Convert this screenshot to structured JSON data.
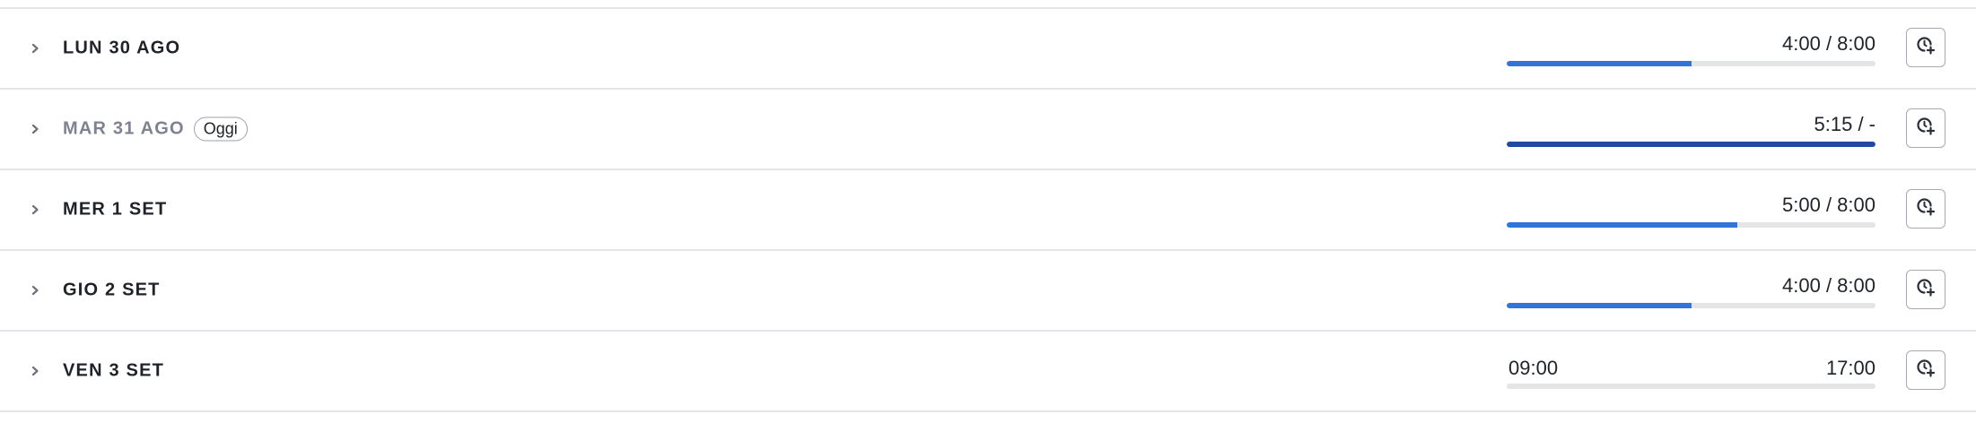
{
  "colors": {
    "progress_fill": "#3274d9",
    "progress_fill_over": "#1f4aa0",
    "progress_track": "#e4e5e7",
    "divider": "#e3e5e8",
    "today_label": "#7e838d"
  },
  "days": [
    {
      "label": "LUN 30 AGO",
      "today": false,
      "badge": "",
      "time_text": "4:00 / 8:00",
      "progress": 0.5,
      "add_icon": "clock-plus-icon",
      "expand_icon": "chevron-right-icon"
    },
    {
      "label": "MAR 31 AGO",
      "today": true,
      "badge": "Oggi",
      "time_text": "5:15 / -",
      "progress": 1.0,
      "add_icon": "clock-plus-icon",
      "expand_icon": "chevron-right-icon"
    },
    {
      "label": "MER 1 SET",
      "today": false,
      "badge": "",
      "time_text": "5:00 / 8:00",
      "progress": 0.625,
      "add_icon": "clock-plus-icon",
      "expand_icon": "chevron-right-icon"
    },
    {
      "label": "GIO 2 SET",
      "today": false,
      "badge": "",
      "time_text": "4:00 / 8:00",
      "progress": 0.5,
      "add_icon": "clock-plus-icon",
      "expand_icon": "chevron-right-icon"
    },
    {
      "label": "VEN 3 SET",
      "today": false,
      "badge": "",
      "range_start": "09:00",
      "range_end": "17:00",
      "progress": 0,
      "add_icon": "clock-plus-icon",
      "expand_icon": "chevron-right-icon"
    }
  ]
}
